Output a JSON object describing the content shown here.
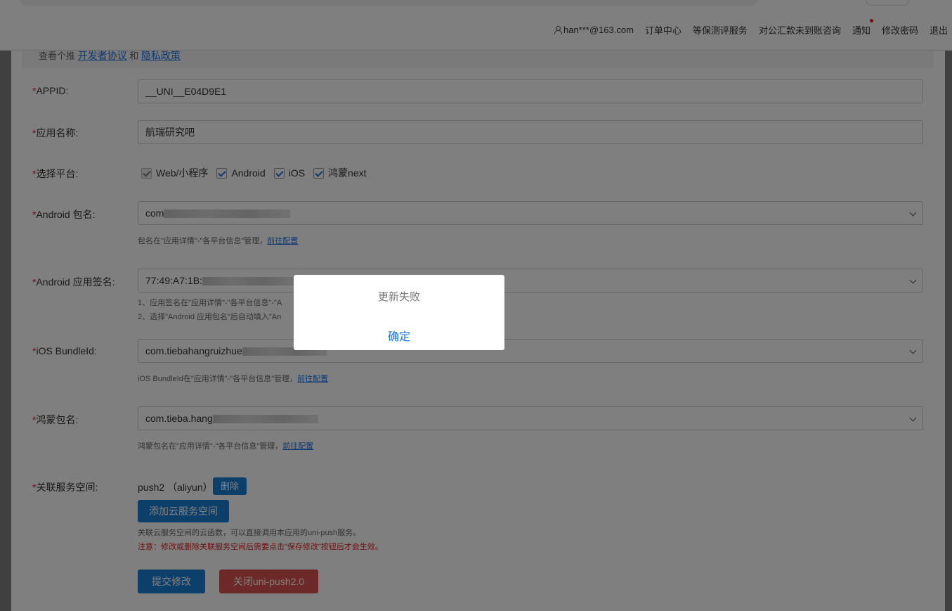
{
  "header": {
    "user": "han***@163.com",
    "nav": [
      "订单中心",
      "等保测评服务",
      "对公汇款未到账咨询",
      "通知",
      "修改密码",
      "退出"
    ]
  },
  "topnote": {
    "prefix": "查看个推",
    "link1": "开发者协议",
    "and": "和",
    "link2": "隐私政策"
  },
  "form": {
    "required_mark": "*",
    "appid": {
      "label": "APPID:",
      "value": "__UNI__E04D9E1"
    },
    "app_name": {
      "label": "应用名称:",
      "value": "航瑞研究吧"
    },
    "platform": {
      "label": "选择平台:",
      "options": [
        {
          "label": "Web/小程序",
          "checked": true,
          "disabled": true
        },
        {
          "label": "Android",
          "checked": true,
          "disabled": false
        },
        {
          "label": "iOS",
          "checked": true,
          "disabled": false
        },
        {
          "label": "鸿蒙next",
          "checked": true,
          "disabled": false
        }
      ]
    },
    "android_pkg": {
      "label": "Android 包名:",
      "value": "com",
      "hint": "包名在\"应用详情\"-\"各平台信息\"管理，",
      "hint_link": "前往配置"
    },
    "android_sign": {
      "label": "Android 应用签名:",
      "value": "77:49:A7:1B:",
      "hint1": "1、应用签名在\"应用详情\"-\"各平台信息\"-\"A",
      "hint2": "2、选择\"Android 应用包名\"后自动填入\"An"
    },
    "ios_bundle": {
      "label": "iOS BundleId:",
      "value": "com.tiebahangruizhue",
      "hint": "iOS BundleId在\"应用详情\"-\"各平台信息\"管理，",
      "hint_link": "前往配置"
    },
    "harmony_pkg": {
      "label": "鸿蒙包名:",
      "value": "com.tieba.hang",
      "hint": "鸿蒙包名在\"应用详情\"-\"各平台信息\"管理，",
      "hint_link": "前往配置"
    },
    "service_space": {
      "label": "关联服务空间:",
      "value": "push2 （aliyun）",
      "delete_label": "删除",
      "add_label": "添加云服务空间",
      "hint": "关联云服务空间的云函数，可以直接调用本应用的uni-push服务。",
      "warning": "注意：修改或删除关联服务空间后需要点击\"保存修改\"按钮后才会生效。"
    },
    "submit_label": "提交修改",
    "close_label": "关闭uni-push2.0"
  },
  "dialog": {
    "message": "更新失败",
    "confirm_label": "确定"
  },
  "colors": {
    "accent": "#1a73e8",
    "primary_button": "#1a7fd6",
    "danger_button": "#d9534f",
    "required": "#e02020"
  }
}
